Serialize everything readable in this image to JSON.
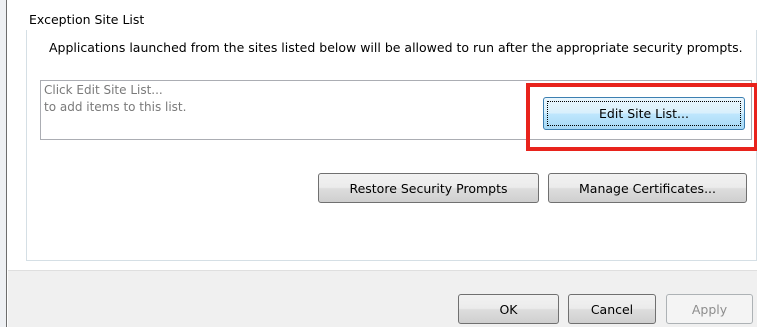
{
  "section": {
    "title": "Exception Site List",
    "description": "Applications launched from the sites listed below will be allowed to run after the appropriate security prompts."
  },
  "site_list": {
    "line1": "Click Edit Site List...",
    "line2": "to add items to this list."
  },
  "buttons": {
    "edit_site_list": "Edit Site List...",
    "restore_security_prompts": "Restore Security Prompts",
    "manage_certificates": "Manage Certificates...",
    "ok": "OK",
    "cancel": "Cancel",
    "apply": "Apply"
  },
  "colors": {
    "highlight": "#e8231c",
    "focused_button": "#bee6fd"
  }
}
